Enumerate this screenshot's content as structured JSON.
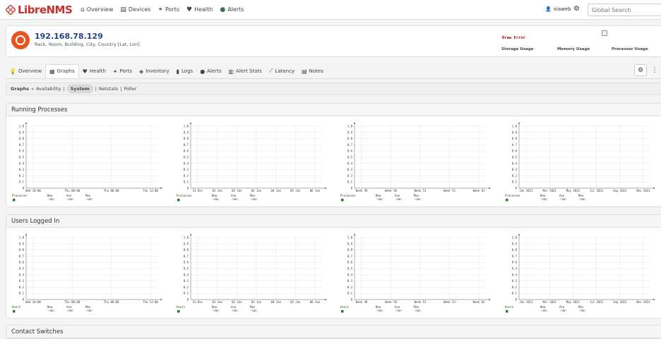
{
  "navbar": {
    "logo": "LibreNMS",
    "items": [
      {
        "label": "Overview",
        "icon": "home-icon",
        "glyph": "⌂"
      },
      {
        "label": "Devices",
        "icon": "server-icon",
        "glyph": "▤"
      },
      {
        "label": "Ports",
        "icon": "link-icon",
        "glyph": "⚭"
      },
      {
        "label": "Health",
        "icon": "heartbeat-icon",
        "glyph": "♥"
      },
      {
        "label": "Alerts",
        "icon": "exclamation-icon",
        "glyph": "●"
      }
    ],
    "user": "viaweb",
    "search_placeholder": "Global Search"
  },
  "device": {
    "ip": "192.168.78.129",
    "location": "Rack, Room, Building, City, Country [Lat, Lon]",
    "draw_error": "Draw Error",
    "stats": [
      "Storage Usage",
      "Memory Usage",
      "Processor Usage"
    ]
  },
  "tabs": [
    {
      "label": "Overview",
      "glyph": "💡"
    },
    {
      "label": "Graphs",
      "glyph": "▦",
      "active": true
    },
    {
      "label": "Health",
      "glyph": "♥"
    },
    {
      "label": "Ports",
      "glyph": "⚭"
    },
    {
      "label": "Inventory",
      "glyph": "◈"
    },
    {
      "label": "Logs",
      "glyph": "▮"
    },
    {
      "label": "Alerts",
      "glyph": "●"
    },
    {
      "label": "Alert Stats",
      "glyph": "▥"
    },
    {
      "label": "Latency",
      "glyph": "⟋"
    },
    {
      "label": "Notes",
      "glyph": "▤"
    }
  ],
  "breadcrumb": {
    "root": "Graphs",
    "separator": "»",
    "items": [
      "Availability",
      "System",
      "Netstats",
      "Poller"
    ],
    "selected": "System"
  },
  "colors": {
    "accent": "#1c4587",
    "legend_square": "#2c7a2c",
    "grid": "#e3b2b2"
  },
  "chart_data": [
    {
      "panel": "Running Processes",
      "series_label": "Processes",
      "type": "line",
      "ylim": [
        0,
        1.0
      ],
      "yticks": [
        "0",
        "0.1",
        "0.2",
        "0.3",
        "0.4",
        "0.5",
        "0.6",
        "0.7",
        "0.8",
        "0.9",
        "1.0"
      ],
      "xticks": [
        "Wed 18:00",
        "Thu 00:00",
        "Thu 06:00",
        "Thu 12:00"
      ],
      "legend": {
        "headers": [
          "Now",
          "Ave",
          "Max"
        ],
        "values": [
          "-nan",
          "-nan",
          "-nan"
        ]
      }
    },
    {
      "panel": "Running Processes",
      "series_label": "Processes",
      "type": "line",
      "ylim": [
        0,
        1.0
      ],
      "yticks": [
        "0",
        "0.1",
        "0.2",
        "0.3",
        "0.4",
        "0.5",
        "0.6",
        "0.7",
        "0.8",
        "0.9",
        "1.0"
      ],
      "xticks": [
        "31 Dec",
        "01 Jan",
        "02 Jan",
        "03 Jan",
        "04 Jan",
        "05 Jan",
        "06 Jan"
      ],
      "legend": {
        "headers": [
          "Now",
          "Ave",
          "Max"
        ],
        "values": [
          "-nan",
          "-nan",
          "-nan"
        ]
      }
    },
    {
      "panel": "Running Processes",
      "series_label": "Processes",
      "type": "line",
      "ylim": [
        0,
        1.0
      ],
      "yticks": [
        "0",
        "0.1",
        "0.2",
        "0.3",
        "0.4",
        "0.5",
        "0.6",
        "0.7",
        "0.8",
        "0.9",
        "1.0"
      ],
      "xticks": [
        "Week 49",
        "Week 50",
        "Week 51",
        "Week 52",
        "Week 01"
      ],
      "legend": {
        "headers": [
          "Now",
          "Ave",
          "Max"
        ],
        "values": [
          "-nan",
          "-nan",
          "-nan"
        ]
      }
    },
    {
      "panel": "Running Processes",
      "series_label": "Processes",
      "type": "line",
      "ylim": [
        0,
        1.0
      ],
      "yticks": [
        "0",
        "0.1",
        "0.2",
        "0.3",
        "0.4",
        "0.5",
        "0.6",
        "0.7",
        "0.8",
        "0.9",
        "1.0"
      ],
      "xticks": [
        "Jan 2021",
        "Mar 2021",
        "May 2021",
        "Jul 2021",
        "Sep 2021",
        "Nov 2021"
      ],
      "legend": {
        "headers": [
          "Now",
          "Ave",
          "Max"
        ],
        "values": [
          "-nan",
          "-nan",
          "-nan"
        ]
      }
    },
    {
      "panel": "Users Logged In",
      "series_label": "Users",
      "type": "line",
      "ylim": [
        0,
        1.0
      ],
      "yticks": [
        "0",
        "0.1",
        "0.2",
        "0.3",
        "0.4",
        "0.5",
        "0.6",
        "0.7",
        "0.8",
        "0.9",
        "1.0"
      ],
      "xticks": [
        "Wed 18:00",
        "Thu 00:00",
        "Thu 06:00",
        "Thu 12:00"
      ],
      "legend": {
        "headers": [
          "Now",
          "Ave",
          "Max"
        ],
        "values": [
          "-nan",
          "-nan",
          "-nan"
        ]
      }
    },
    {
      "panel": "Users Logged In",
      "series_label": "Users",
      "type": "line",
      "ylim": [
        0,
        1.0
      ],
      "yticks": [
        "0",
        "0.1",
        "0.2",
        "0.3",
        "0.4",
        "0.5",
        "0.6",
        "0.7",
        "0.8",
        "0.9",
        "1.0"
      ],
      "xticks": [
        "31 Dec",
        "01 Jan",
        "02 Jan",
        "03 Jan",
        "04 Jan",
        "05 Jan",
        "06 Jan"
      ],
      "legend": {
        "headers": [
          "Now",
          "Ave",
          "Max"
        ],
        "values": [
          "-nan",
          "-nan",
          "-nan"
        ]
      }
    },
    {
      "panel": "Users Logged In",
      "series_label": "Users",
      "type": "line",
      "ylim": [
        0,
        1.0
      ],
      "yticks": [
        "0",
        "0.1",
        "0.2",
        "0.3",
        "0.4",
        "0.5",
        "0.6",
        "0.7",
        "0.8",
        "0.9",
        "1.0"
      ],
      "xticks": [
        "Week 49",
        "Week 50",
        "Week 51",
        "Week 52",
        "Week 01"
      ],
      "legend": {
        "headers": [
          "Now",
          "Ave",
          "Max"
        ],
        "values": [
          "-nan",
          "-nan",
          "-nan"
        ]
      }
    },
    {
      "panel": "Users Logged In",
      "series_label": "Users",
      "type": "line",
      "ylim": [
        0,
        1.0
      ],
      "yticks": [
        "0",
        "0.1",
        "0.2",
        "0.3",
        "0.4",
        "0.5",
        "0.6",
        "0.7",
        "0.8",
        "0.9",
        "1.0"
      ],
      "xticks": [
        "Jan 2021",
        "Mar 2021",
        "May 2021",
        "Jul 2021",
        "Sep 2021",
        "Nov 2021"
      ],
      "legend": {
        "headers": [
          "Now",
          "Ave",
          "Max"
        ],
        "values": [
          "-nan",
          "-nan",
          "-nan"
        ]
      }
    }
  ],
  "panels": [
    {
      "title": "Running Processes"
    },
    {
      "title": "Users Logged In"
    },
    {
      "title": "Contact Switches"
    }
  ]
}
